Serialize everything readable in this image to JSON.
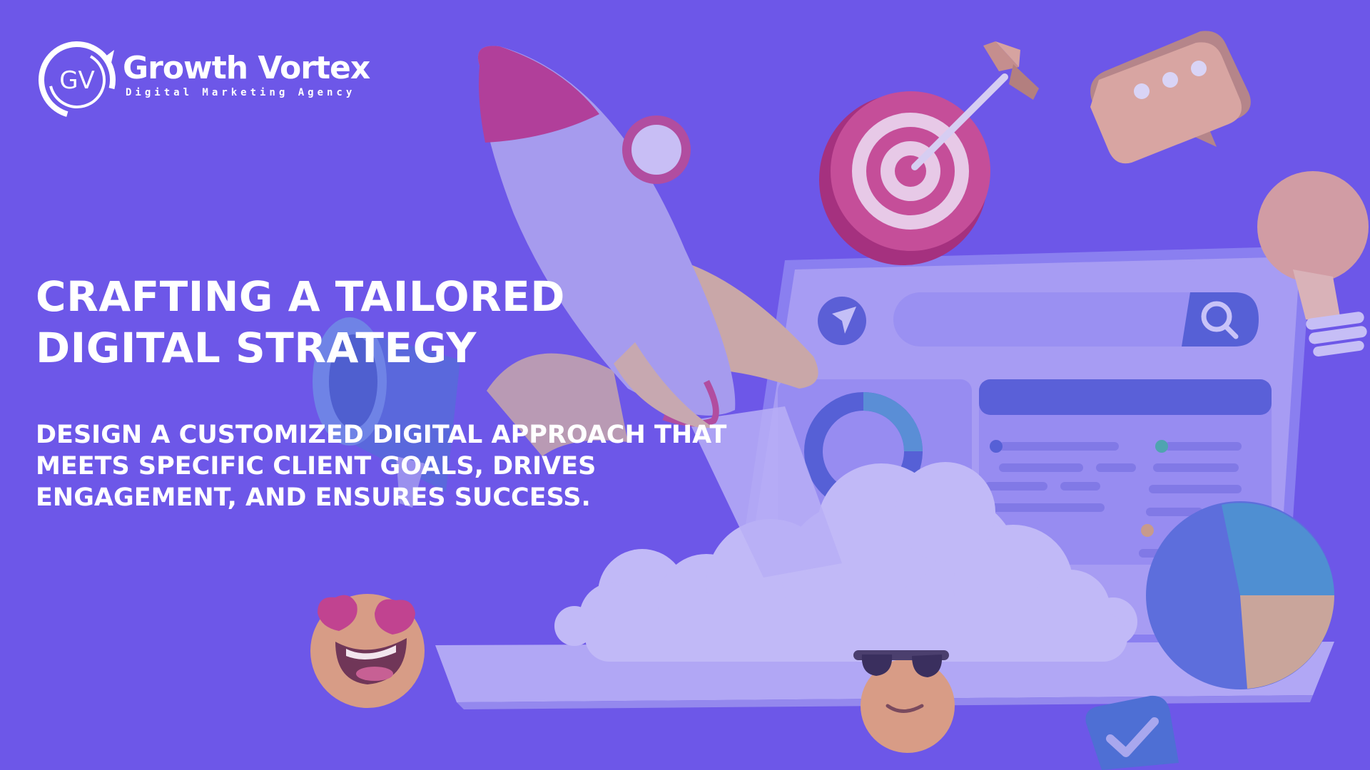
{
  "brand": {
    "name": "Growth Vortex",
    "tagline": "Digital Marketing Agency",
    "monogram": "GV"
  },
  "hero": {
    "headline": "CRAFTING A TAILORED DIGITAL STRATEGY",
    "subheadline": "DESIGN A CUSTOMIZED DIGITAL APPROACH THAT MEETS SPECIFIC CLIENT GOALS, DRIVES ENGAGEMENT, AND ENSURES SUCCESS."
  },
  "illustration": {
    "icons": [
      "rocket-icon",
      "target-icon",
      "arrow-icon",
      "chat-bubble-icon",
      "lightbulb-icon",
      "megaphone-icon",
      "laptop-icon",
      "search-icon",
      "navigation-icon",
      "donut-chart-icon",
      "pie-chart-icon",
      "heart-eyes-emoji-icon",
      "sunglasses-emoji-icon",
      "checkmark-icon",
      "cloud-icon"
    ]
  },
  "colors": {
    "background": "#6d57e8",
    "text": "#ffffff"
  }
}
